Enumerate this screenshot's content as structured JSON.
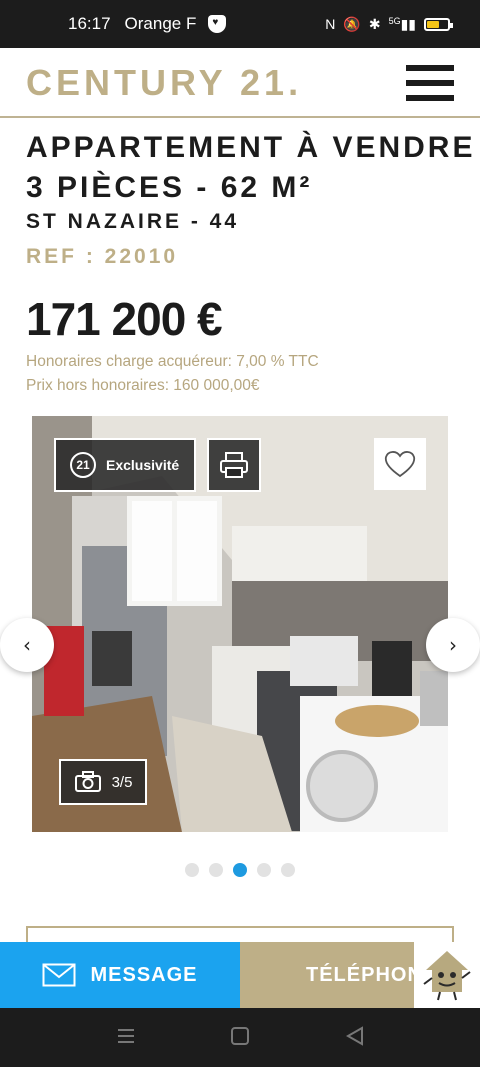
{
  "status_bar": {
    "time": "16:17",
    "carrier": "Orange F",
    "signal": "5G"
  },
  "header": {
    "logo": "CENTURY 21."
  },
  "listing": {
    "title_line1": "APPARTEMENT À VENDRE",
    "title_line2": "3 PIÈCES - 62 M²",
    "city": "ST NAZAIRE - 44",
    "ref": "REF : 22010",
    "price": "171 200 €",
    "fees_line1": "Honoraires charge acquéreur: 7,00 % TTC",
    "fees_line2": "Prix hors honoraires: 160 000,00€"
  },
  "gallery": {
    "badge": "Exclusivité",
    "badge_logo": "21",
    "counter": "3/5",
    "current_index": 3,
    "total": 5
  },
  "actions": {
    "message_label": "MESSAGE",
    "phone_label": "TÉLÉPHONE"
  },
  "colors": {
    "gold": "#beaf87",
    "blue": "#1ba3ef",
    "dark": "#1c1c1c"
  }
}
